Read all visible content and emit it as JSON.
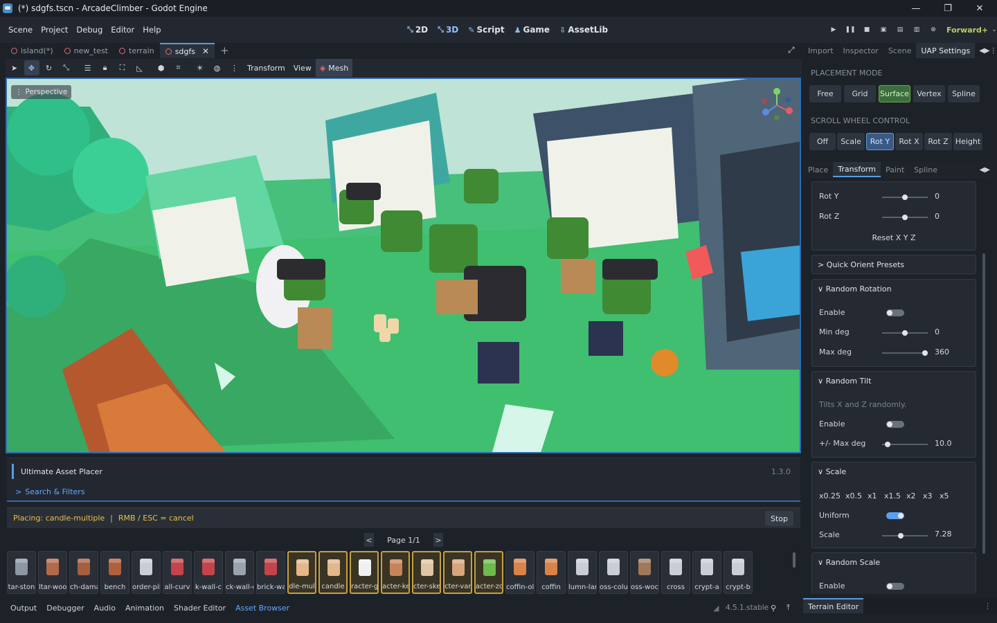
{
  "window": {
    "title": "(*) sdgfs.tscn - ArcadeClimber - Godot Engine",
    "minimize": "—",
    "restore": "❐",
    "close": "✕"
  },
  "menubar": {
    "menus": [
      "Scene",
      "Project",
      "Debug",
      "Editor",
      "Help"
    ],
    "main_screens": [
      "2D",
      "3D",
      "Script",
      "Game",
      "AssetLib"
    ],
    "renderer": "Forward+"
  },
  "scene_tabs": [
    {
      "label": "island(*)",
      "active": false
    },
    {
      "label": "new_test",
      "active": false
    },
    {
      "label": "terrain",
      "active": false
    },
    {
      "label": "sdgfs",
      "active": true
    }
  ],
  "viewport_toolbar": {
    "transform": "Transform",
    "view": "View",
    "mesh": "Mesh"
  },
  "viewport": {
    "perspective": "Perspective"
  },
  "uap": {
    "title": "Ultimate Asset Placer",
    "version": "1.3.0",
    "search": "Search & Filters",
    "placing_status": "Placing: candle-multiple",
    "sep": "|",
    "cancel_hint": "RMB / ESC = cancel",
    "stop": "Stop",
    "page": "Page 1/1",
    "prev": "<",
    "next": ">"
  },
  "assets": [
    {
      "label": "tar-ston",
      "selected": false,
      "color": "#8e98a4"
    },
    {
      "label": "ltar-woo",
      "selected": false,
      "color": "#b46a4a"
    },
    {
      "label": "ch-dama",
      "selected": false,
      "color": "#a55f3f"
    },
    {
      "label": "bench",
      "selected": false,
      "color": "#b0603c"
    },
    {
      "label": "order-pill",
      "selected": false,
      "color": "#c9ced6"
    },
    {
      "label": "all-curv",
      "selected": false,
      "color": "#c4444c"
    },
    {
      "label": "k-wall-c",
      "selected": false,
      "color": "#c4444c"
    },
    {
      "label": "ck-wall-e",
      "selected": false,
      "color": "#9aa2ad"
    },
    {
      "label": "brick-wal",
      "selected": false,
      "color": "#c4444c"
    },
    {
      "label": "dle-mul",
      "selected": true,
      "color": "#e3b78a"
    },
    {
      "label": "candle",
      "selected": true,
      "color": "#e3b78a"
    },
    {
      "label": "racter-g",
      "selected": true,
      "color": "#f0f0f4"
    },
    {
      "label": "acter-ke",
      "selected": true,
      "color": "#c7845a"
    },
    {
      "label": "cter-ske",
      "selected": true,
      "color": "#e1c4a4"
    },
    {
      "label": "cter-var",
      "selected": true,
      "color": "#d9a47c"
    },
    {
      "label": "acter-zo",
      "selected": true,
      "color": "#6dbb4a"
    },
    {
      "label": "coffin-ol",
      "selected": false,
      "color": "#d9824a"
    },
    {
      "label": "coffin",
      "selected": false,
      "color": "#d9824a"
    },
    {
      "label": "lumn-lar",
      "selected": false,
      "color": "#c9ced6"
    },
    {
      "label": "oss-colu",
      "selected": false,
      "color": "#c9ced6"
    },
    {
      "label": "oss-woc",
      "selected": false,
      "color": "#a0785a"
    },
    {
      "label": "cross",
      "selected": false,
      "color": "#c9ced6"
    },
    {
      "label": "crypt-a",
      "selected": false,
      "color": "#c9ced6"
    },
    {
      "label": "crypt-b",
      "selected": false,
      "color": "#c9ced6"
    }
  ],
  "bottom_tabs": [
    "Output",
    "Debugger",
    "Audio",
    "Animation",
    "Shader Editor",
    "Asset Browser"
  ],
  "version_label": "4.5.1.stable",
  "dock": {
    "tabs": [
      "Import",
      "Inspector",
      "Scene",
      "UAP Settings"
    ],
    "placement_mode_label": "PLACEMENT MODE",
    "placement_modes": [
      "Free",
      "Grid",
      "Surface",
      "Vertex",
      "Spline"
    ],
    "placement_active": "Surface",
    "scroll_label": "SCROLL WHEEL CONTROL",
    "scroll_modes": [
      "Off",
      "Scale",
      "Rot Y",
      "Rot X",
      "Rot Z",
      "Height"
    ],
    "scroll_active": "Rot Y",
    "subtabs": [
      "Place",
      "Transform",
      "Paint",
      "Spline"
    ],
    "subtab_active": "Transform",
    "rot_y": {
      "label": "Rot Y",
      "value": "0",
      "fraction": 0.5
    },
    "rot_z": {
      "label": "Rot Z",
      "value": "0",
      "fraction": 0.5
    },
    "reset": "Reset X Y Z",
    "quick_orient": "Quick Orient Presets",
    "random_rotation": {
      "header": "Random Rotation",
      "enable_label": "Enable",
      "min_label": "Min deg",
      "min_value": "0",
      "max_label": "Max deg",
      "max_value": "360"
    },
    "random_tilt": {
      "header": "Random Tilt",
      "desc": "Tilts X and Z randomly.",
      "enable_label": "Enable",
      "max_label": "+/- Max deg",
      "max_value": "10.0"
    },
    "scale": {
      "header": "Scale",
      "presets": [
        "x0.25",
        "x0.5",
        "x1",
        "x1.5",
        "x2",
        "x3",
        "x5"
      ],
      "uniform_label": "Uniform",
      "scale_label": "Scale",
      "scale_value": "7.28"
    },
    "random_scale": {
      "header": "Random Scale",
      "enable_label": "Enable"
    },
    "terrain_editor": "Terrain Editor"
  },
  "colors": {
    "accent": "#5a9de0",
    "active_green": "#3b6e3d",
    "selected_asset": "#c9a13c",
    "warning_text": "#e8c04a"
  }
}
